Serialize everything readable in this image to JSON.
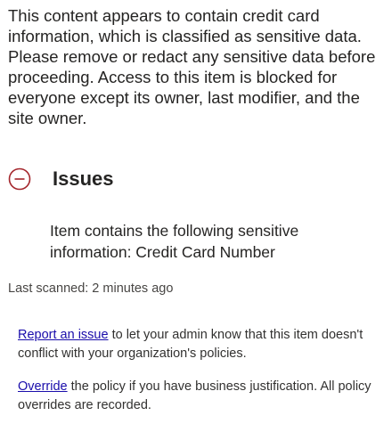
{
  "intro": {
    "text": "This content appears to contain credit card information, which is classified as sensitive data. Please remove or redact any sensitive data before proceeding. Access to this item is blocked for everyone except its owner, last modifier, and the site owner."
  },
  "issues": {
    "icon": "collapse-minus-icon",
    "title": "Issues",
    "detail": "Item contains the following sensitive information: Credit Card Number"
  },
  "last_scanned": {
    "label": "Last scanned:",
    "value": "2 minutes ago"
  },
  "report": {
    "link_label": "Report an issue",
    "text": " to let your admin know that this item doesn't conflict with your organization's policies."
  },
  "override": {
    "link_label": "Override",
    "text": " the policy if you have business justification. All policy overrides are recorded."
  },
  "colors": {
    "icon_red": "#a4262c",
    "link": "#1a0dab",
    "text": "#252423"
  }
}
